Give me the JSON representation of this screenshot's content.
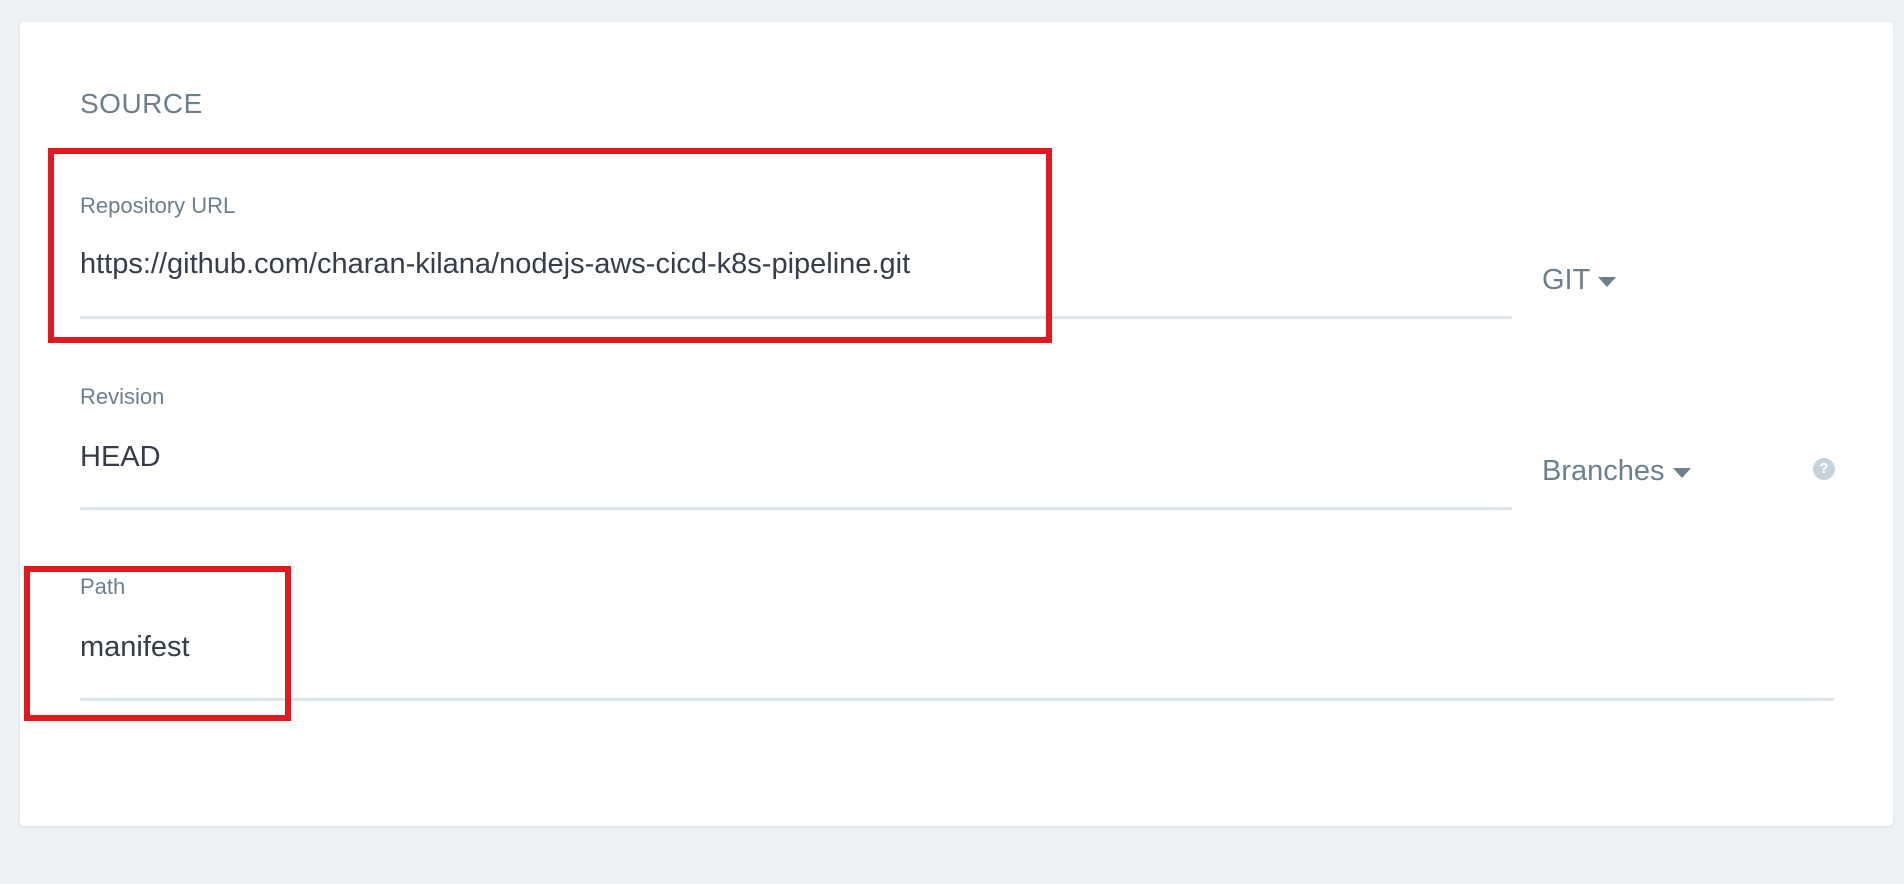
{
  "source": {
    "section_title": "SOURCE",
    "repository_url": {
      "label": "Repository URL",
      "value": "https://github.com/charan-kilana/nodejs-aws-cicd-k8s-pipeline.git",
      "type_dropdown": "GIT"
    },
    "revision": {
      "label": "Revision",
      "value": "HEAD",
      "ref_dropdown": "Branches",
      "help_icon": "help-circle-icon"
    },
    "path": {
      "label": "Path",
      "value": "manifest"
    }
  },
  "colors": {
    "background": "#eef1f4",
    "card": "#ffffff",
    "label": "#6d7f8b",
    "value": "#363c4a",
    "underline": "#dee6eb",
    "highlight": "#e0191f"
  }
}
